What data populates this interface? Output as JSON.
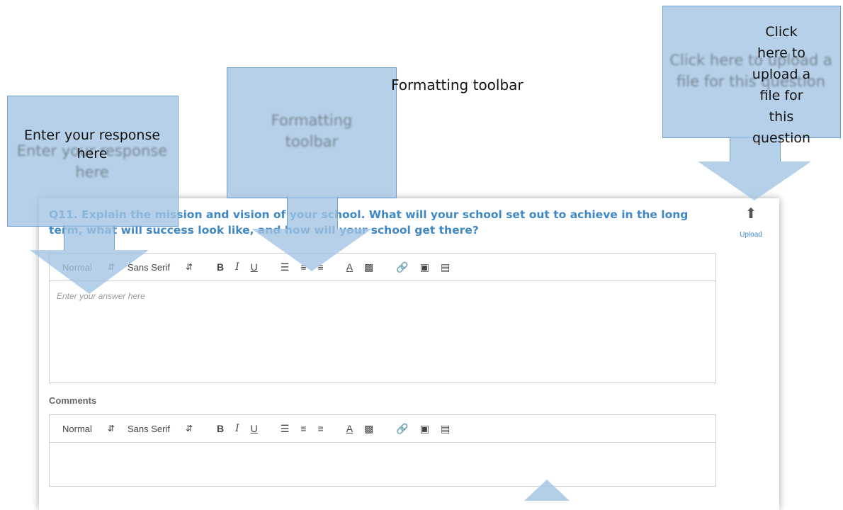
{
  "question": {
    "text": "Q11. Explain the mission and vision of your school. What will your school set out to achieve in the long term, what will success look like, and how will your school get there?",
    "upload_label": "Upload"
  },
  "editor": {
    "format_select": "Normal",
    "font_select": "Sans Serif",
    "placeholder": "Enter your answer here"
  },
  "comments": {
    "label": "Comments",
    "format_select": "Normal",
    "font_select": "Sans Serif"
  },
  "callouts": {
    "response_ghost": "Enter your response here",
    "response_label": "Enter your response here",
    "toolbar_ghost": "Formatting toolbar",
    "toolbar_floating": "Formatting toolbar",
    "upload_ghost": "Click here to upload a file for this question",
    "upload_label": "Click here to upload a file for this question"
  },
  "toolbar_icons": [
    "bold-icon",
    "italic-icon",
    "underline-icon",
    "ordered-list-icon",
    "bullet-list-icon",
    "align-icon",
    "text-color-icon",
    "background-color-icon",
    "link-icon",
    "image-icon",
    "video-icon"
  ],
  "colors": {
    "callout_fill": "#a0c3e1",
    "callout_border": "#6e9fcf",
    "question_text": "#3f88c5"
  }
}
